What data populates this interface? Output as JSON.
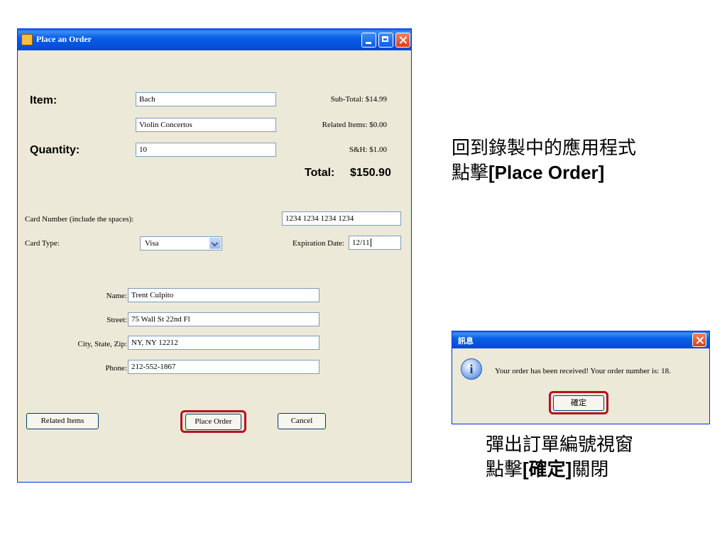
{
  "window": {
    "title": "Place an Order"
  },
  "order": {
    "item_label": "Item:",
    "item_line1": "Bach",
    "item_line2": "Violin Concertos",
    "quantity_label": "Quantity:",
    "quantity_value": "10",
    "subtotal": "Sub-Total: $14.99",
    "related_items_cost": "Related Items: $0.00",
    "shipping": "S&H: $1.00",
    "total_label": "Total:",
    "total_value": "$150.90"
  },
  "payment": {
    "card_number_label": "Card Number (include the spaces):",
    "card_number_value": "1234 1234 1234 1234",
    "card_type_label": "Card Type:",
    "card_type_value": "Visa",
    "expiration_label": "Expiration Date:",
    "expiration_value": "12/11"
  },
  "address": {
    "name_label": "Name:",
    "name_value": "Trent Culpito",
    "street_label": "Street:",
    "street_value": "75 Wall St 22nd Fl",
    "city_label": "City, State, Zip:",
    "city_value": "NY, NY 12212",
    "phone_label": "Phone:",
    "phone_value": "212-552-1867"
  },
  "buttons": {
    "related_items": "Related Items",
    "place_order": "Place Order",
    "cancel": "Cancel"
  },
  "dialog": {
    "title": "訊息",
    "message": "Your order has been received!  Your order number is: 18.",
    "ok": "確定"
  },
  "notes": {
    "top_line1": "回到錄製中的應用程式",
    "top_line2_prefix": "點擊",
    "top_line2_bold": "[Place Order]",
    "bottom_line1": "彈出訂單編號視窗",
    "bottom_line2_prefix": "點擊",
    "bottom_line2_bold": "[確定]",
    "bottom_line2_suffix": "關閉"
  },
  "colors": {
    "highlight": "#b5141c",
    "titlebar": "#0a5fe8",
    "window_bg": "#ece9d8"
  }
}
